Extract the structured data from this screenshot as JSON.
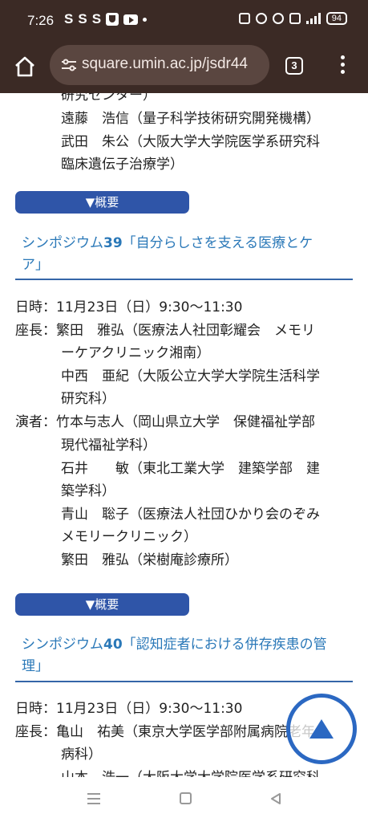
{
  "status_bar": {
    "time": "7:26",
    "left_icons": [
      "S",
      "S",
      "S"
    ],
    "battery": "94"
  },
  "browser": {
    "url": "square.umin.ac.jp/jsdr44",
    "tab_count": "3"
  },
  "content": {
    "top_lines": [
      "研究センター）",
      "遠藤　浩信（量子科学技術研究開発機構）",
      "武田　朱公（大阪大学大学院医学系研究科",
      "臨床遺伝子治療学）"
    ],
    "toggle_label": "▼概要",
    "sym39": {
      "title_prefix": "シンポジウム",
      "title_number": "39",
      "title_rest_line1": "「自分らしさを支える医療とケ",
      "title_line2": "ア」",
      "lines": [
        "日時：11月23日（日）9:30～11:30",
        "座長：繁田　雅弘（医療法人社団彰耀会　メモリ",
        "ーケアクリニック湘南）",
        "中西　亜紀（大阪公立大学大学院生活科学",
        "研究科）",
        "演者：竹本与志人（岡山県立大学　保健福祉学部",
        "現代福祉学科）",
        "石井　　敏（東北工業大学　建築学部　建",
        "築学科）",
        "青山　聡子（医療法人社団ひかり会のぞみ",
        "メモリークリニック）",
        "繁田　雅弘（栄樹庵診療所）"
      ]
    },
    "sym40": {
      "title_prefix": "シンポジウム",
      "title_number": "40",
      "title_rest_line1": "「認知症者における併存疾患の管",
      "title_line2": "理」",
      "lines": [
        "日時：11月23日（日）9:30～11:30",
        "座長：亀山　祐美（東京大学医学部附属病院老年",
        "病科）",
        "山本　浩一（大阪大学大学院医学系研究科"
      ]
    }
  },
  "icons": {
    "home": "home-icon",
    "tune": "tune-icon",
    "menu": "more-vert-icon",
    "scroll_top": "arrow-up-icon"
  },
  "colors": {
    "chrome": "#3b2a25",
    "accent_button": "#2f55a8",
    "title_link": "#2a78b8",
    "divider": "#3566a8",
    "scroll_top_ring": "#2b68c2"
  }
}
